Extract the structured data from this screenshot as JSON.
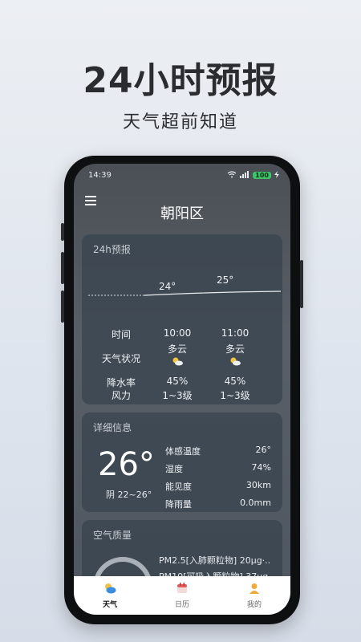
{
  "promo": {
    "title": "24小时预报",
    "subtitle": "天气超前知道"
  },
  "status": {
    "time": "14:39",
    "battery": "100"
  },
  "header": {
    "city": "朝阳区"
  },
  "forecast_card": {
    "title": "24h预报",
    "temps": [
      "24°",
      "25°"
    ],
    "row_labels": [
      "时间",
      "天气状况",
      "降水率",
      "风力"
    ],
    "hours": [
      {
        "time": "10:00",
        "condition": "多云",
        "precip": "45%",
        "wind": "1~3级"
      },
      {
        "time": "11:00",
        "condition": "多云",
        "precip": "45%",
        "wind": "1~3级"
      }
    ]
  },
  "detail_card": {
    "title": "详细信息",
    "temp": "26°",
    "summary": "阴  22~26°",
    "rows": [
      {
        "key": "体感温度",
        "value": "26°"
      },
      {
        "key": "湿度",
        "value": "74%"
      },
      {
        "key": "能见度",
        "value": "30km"
      },
      {
        "key": "降雨量",
        "value": "0.0mm"
      }
    ]
  },
  "aqi_card": {
    "title": "空气质量",
    "rows": [
      "PM2.5[入肺颗粒物] 20μg·...",
      "PM10[可吸入颗粒物] 37μg..."
    ]
  },
  "bottom_nav": {
    "items": [
      {
        "label": "天气",
        "icon": "weather-icon",
        "color": "#3b8ede"
      },
      {
        "label": "日历",
        "icon": "calendar-icon",
        "color": "#e35b5b"
      },
      {
        "label": "我的",
        "icon": "profile-icon",
        "color": "#f0a93b"
      }
    ]
  }
}
